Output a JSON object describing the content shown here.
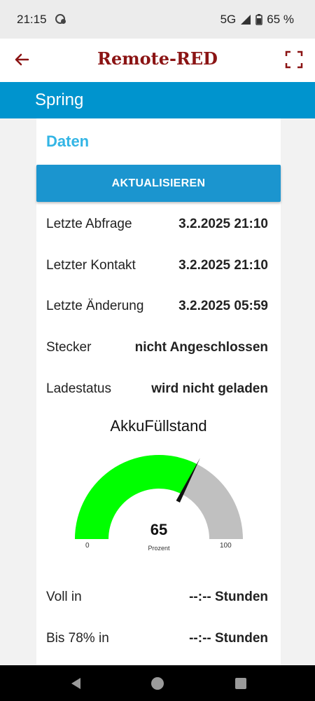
{
  "status_bar": {
    "time": "21:15",
    "network": "5G",
    "battery": "65 %"
  },
  "app_bar": {
    "title": "Remote-RED",
    "back_icon": "arrow-left-icon",
    "fullscreen_icon": "fullscreen-icon"
  },
  "group": {
    "label": "Spring"
  },
  "card": {
    "heading": "Daten",
    "button_label": "AKTUALISIEREN",
    "rows": [
      {
        "key": "Letzte Abfrage",
        "value": "3.2.2025 21:10"
      },
      {
        "key": "Letzter Kontakt",
        "value": "3.2.2025 21:10"
      },
      {
        "key": "Letzte Änderung",
        "value": "3.2.2025 05:59"
      },
      {
        "key": "Stecker",
        "value": "nicht Angeschlossen"
      },
      {
        "key": "Ladestatus",
        "value": "wird nicht geladen"
      }
    ],
    "gauge": {
      "title": "AkkuFüllstand",
      "value": 65,
      "value_text": "65",
      "unit": "Prozent",
      "min": "0",
      "max": "100",
      "fill_color": "#00ff00",
      "track_color": "#c0c0c0"
    },
    "rows2": [
      {
        "key": "Voll in",
        "value": "--:-- Stunden"
      },
      {
        "key": "Bis 78% in",
        "value": "--:-- Stunden"
      }
    ]
  },
  "colors": {
    "title_red": "#8b1414",
    "group_blue": "#0094ce",
    "button_blue": "#1b95cf",
    "heading_blue": "#33b5e5"
  }
}
